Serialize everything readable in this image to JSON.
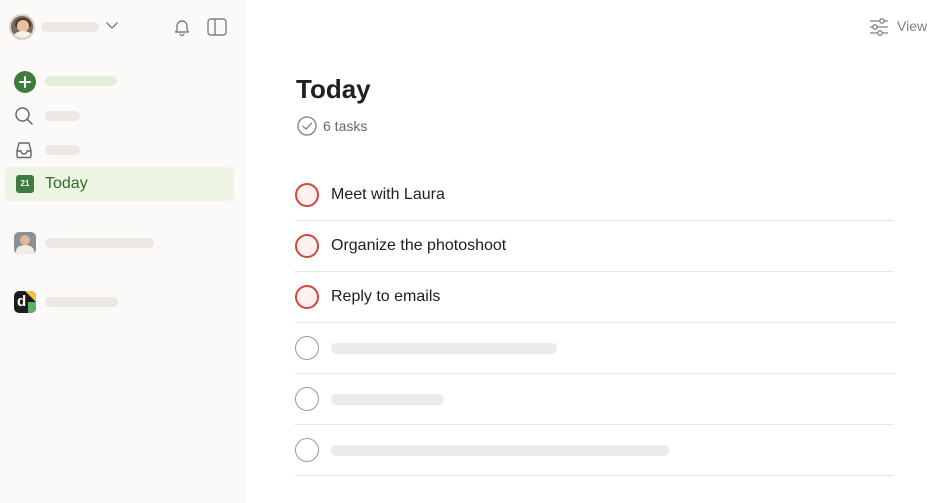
{
  "header": {
    "view_label": "View"
  },
  "sidebar": {
    "today_label": "Today",
    "today_icon_number": "21"
  },
  "main": {
    "title": "Today",
    "task_count": "6 tasks",
    "tasks": [
      {
        "title": "Meet with Laura",
        "priority": "p1"
      },
      {
        "title": "Organize the photoshoot",
        "priority": "p1"
      },
      {
        "title": "Reply to emails",
        "priority": "p1"
      }
    ]
  },
  "colors": {
    "accent": "#3f7b3c",
    "priority_1": "#d1453b",
    "active_bg": "#eef4e4"
  },
  "logo_letter": "d"
}
